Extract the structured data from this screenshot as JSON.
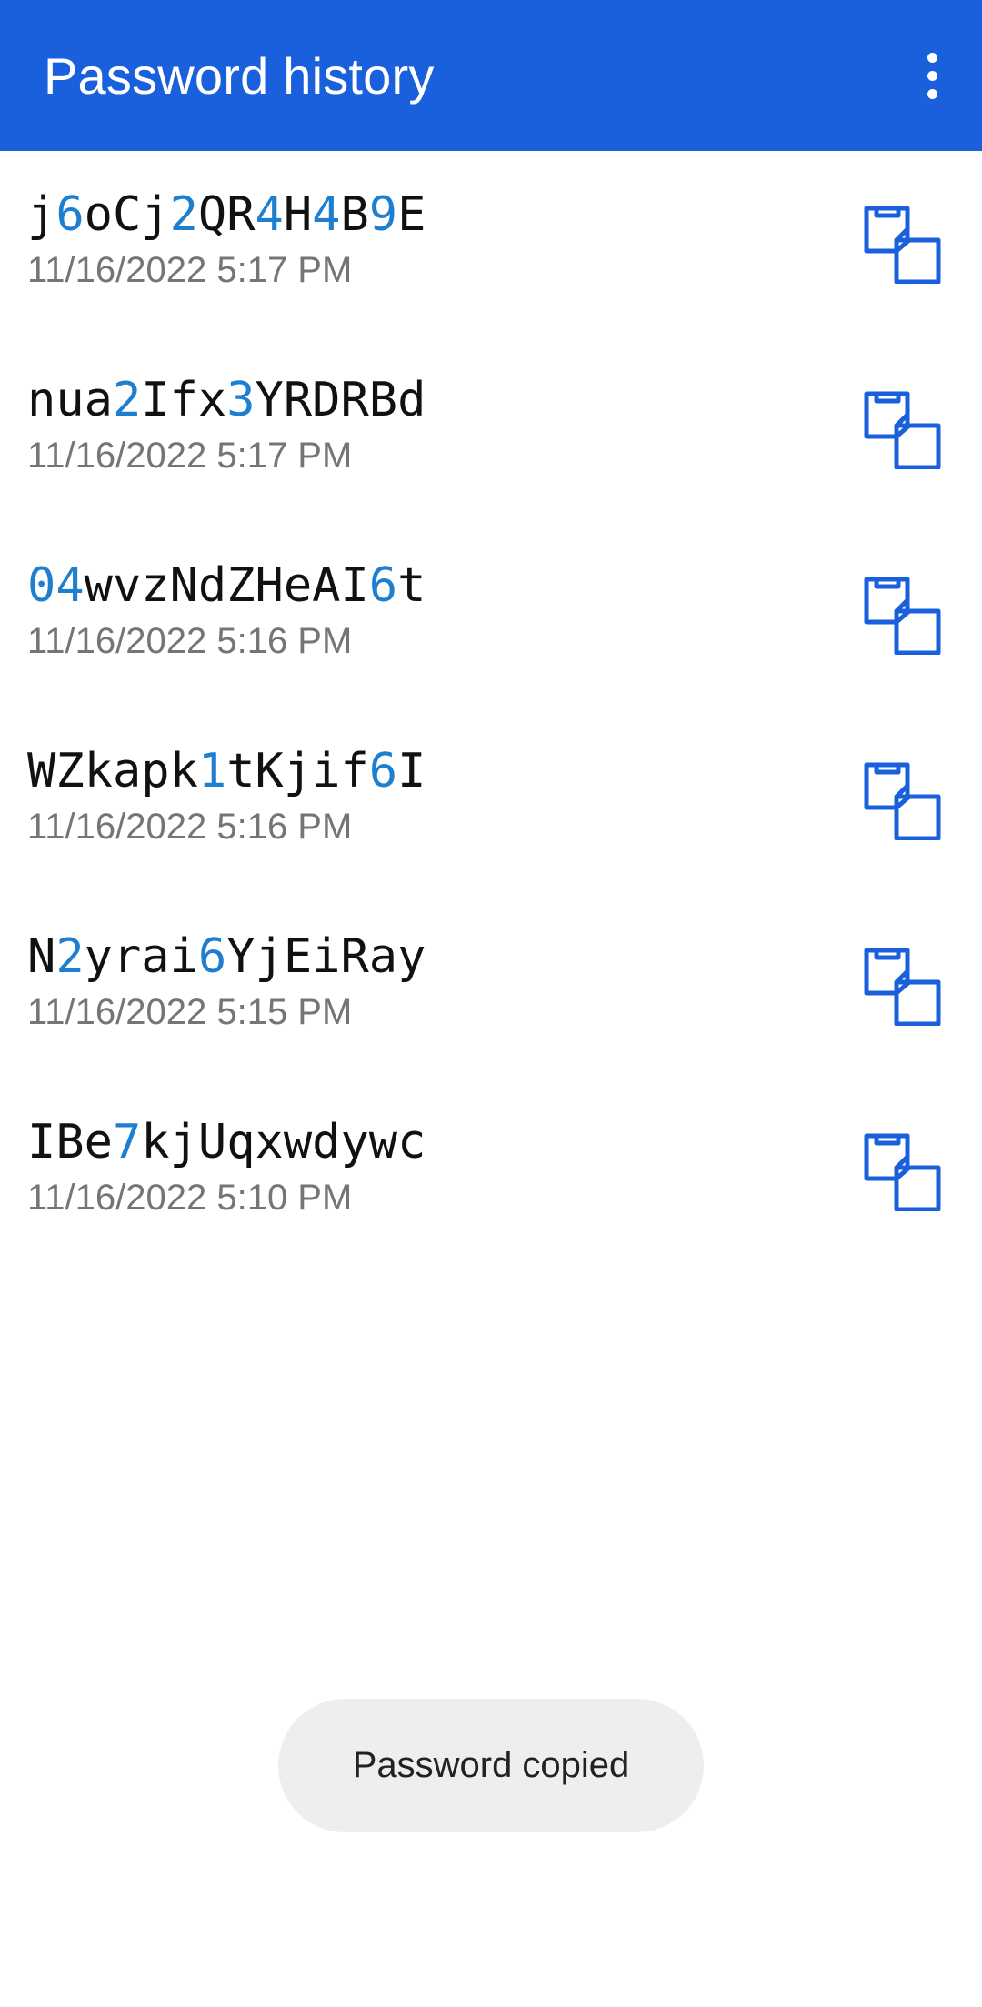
{
  "app_bar": {
    "title": "Password history",
    "menu_icon": "more-vert-icon",
    "color": "#1a5fdb"
  },
  "history": [
    {
      "password": "j6oCj2QR4H4B9E",
      "timestamp": "11/16/2022 5:17 PM"
    },
    {
      "password": "nua2Ifx3YRDRBd",
      "timestamp": "11/16/2022 5:17 PM"
    },
    {
      "password": "04wvzNdZHeAI6t",
      "timestamp": "11/16/2022 5:16 PM"
    },
    {
      "password": "WZkapk1tKjif6I",
      "timestamp": "11/16/2022 5:16 PM"
    },
    {
      "password": "N2yrai6YjEiRay",
      "timestamp": "11/16/2022 5:15 PM"
    },
    {
      "password": "IBe7kjUqxwdywc",
      "timestamp": "11/16/2022 5:10 PM"
    }
  ],
  "copy_icon": "copy-icon",
  "digit_color": "#1e7fd0",
  "toast": {
    "message": "Password copied"
  }
}
